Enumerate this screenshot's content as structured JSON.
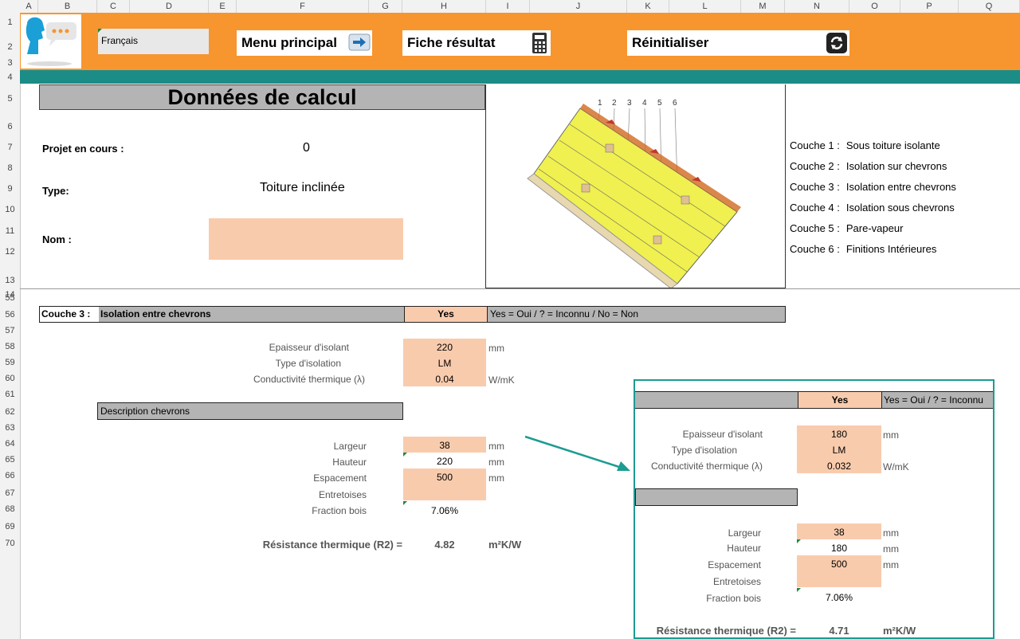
{
  "columns": [
    "A",
    "B",
    "C",
    "D",
    "E",
    "F",
    "G",
    "H",
    "I",
    "J",
    "K",
    "L",
    "M",
    "N",
    "O",
    "P",
    "Q"
  ],
  "rows": [
    "1",
    "2",
    "3",
    "4",
    "5",
    "6",
    "7",
    "8",
    "9",
    "10",
    "11",
    "12",
    "13",
    "14",
    "55",
    "56",
    "57",
    "58",
    "59",
    "60",
    "61",
    "62",
    "63",
    "64",
    "65",
    "66",
    "67",
    "68",
    "69",
    "70"
  ],
  "toolbar": {
    "language": "Français",
    "menu_label": "Menu principal",
    "result_label": "Fiche résultat",
    "reset_label": "Réinitialiser"
  },
  "header": {
    "title": "Données de calcul",
    "project_label": "Projet en cours :",
    "project_value": "0",
    "type_label": "Type:",
    "type_value": "Toiture inclinée",
    "name_label": "Nom :",
    "name_value": ""
  },
  "diagram": {
    "numbers": [
      "1",
      "2",
      "3",
      "4",
      "5",
      "6"
    ]
  },
  "layers": [
    {
      "num": "Couche 1 :",
      "name": "Sous toiture isolante"
    },
    {
      "num": "Couche 2 :",
      "name": "Isolation sur chevrons"
    },
    {
      "num": "Couche 3 :",
      "name": "Isolation entre chevrons"
    },
    {
      "num": "Couche 4 :",
      "name": "Isolation sous chevrons"
    },
    {
      "num": "Couche 5 :",
      "name": "Pare-vapeur"
    },
    {
      "num": "Couche 6 :",
      "name": "Finitions Intérieures"
    }
  ],
  "couche": {
    "label": "Couche 3 :",
    "name": "Isolation entre chevrons",
    "yes": "Yes",
    "legend": "Yes = Oui / ? = Inconnu / No = Non",
    "epaisseur_label": "Epaisseur d'isolant",
    "epaisseur": "220",
    "epaisseur_unit": "mm",
    "type_label": "Type d'isolation",
    "type": "LM",
    "cond_label": "Conductivité thermique (λ)",
    "cond": "0.04",
    "cond_unit": "W/mK",
    "desc": "Description chevrons",
    "largeur_label": "Largeur",
    "largeur": "38",
    "hauteur_label": "Hauteur",
    "hauteur": "220",
    "espacement_label": "Espacement",
    "espacement": "500",
    "entretoises_label": "Entretoises",
    "fraction_label": "Fraction bois",
    "fraction": "7.06%",
    "unit_mm": "mm",
    "res_label": "Résistance thermique (R2) =",
    "res": "4.82",
    "res_unit": "m²K/W"
  },
  "inset": {
    "yes": "Yes",
    "legend": "Yes = Oui / ? = Inconnu",
    "epaisseur_label": "Epaisseur d'isolant",
    "epaisseur": "180",
    "type_label": "Type d'isolation",
    "type": "LM",
    "cond_label": "Conductivité thermique (λ)",
    "cond": "0.032",
    "cond_unit": "W/mK",
    "largeur_label": "Largeur",
    "largeur": "38",
    "hauteur_label": "Hauteur",
    "hauteur": "180",
    "espacement_label": "Espacement",
    "espacement": "500",
    "entretoises_label": "Entretoises",
    "fraction_label": "Fraction bois",
    "fraction": "7.06%",
    "unit_mm": "mm",
    "res_label": "Résistance thermique (R2) =",
    "res": "4.71",
    "res_unit": "m²K/W"
  },
  "colors": {
    "orange": "#f7952f",
    "teal": "#1c8c86",
    "peach": "#f9cbad",
    "grey": "#b4b4b4"
  }
}
